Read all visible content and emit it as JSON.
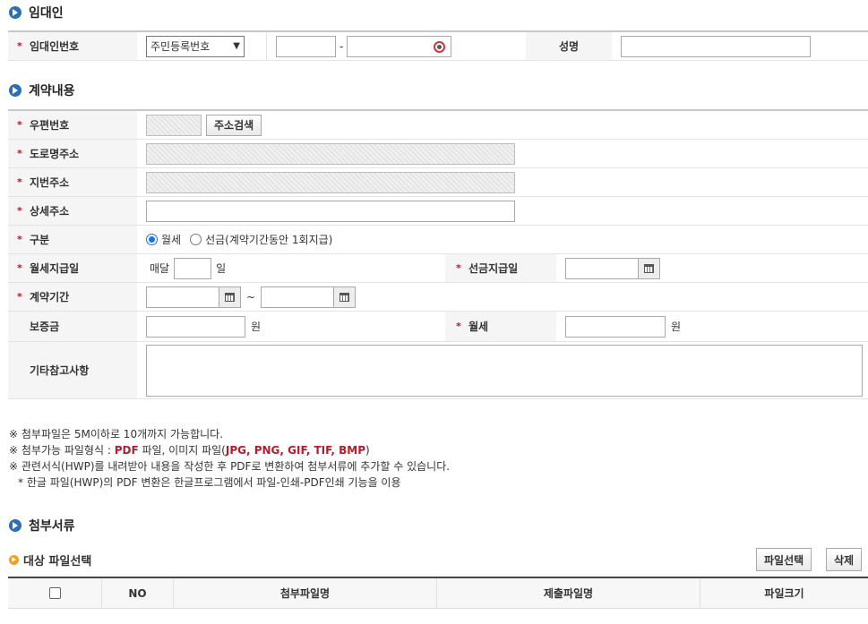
{
  "landlord": {
    "section_title": "임대인",
    "id_label": "임대인번호",
    "id_type_selected": "주민등록번호",
    "id_separator": "-",
    "name_label": "성명"
  },
  "contract": {
    "section_title": "계약내용",
    "postcode_label": "우편번호",
    "address_search_btn": "주소검색",
    "road_address_label": "도로명주소",
    "lot_address_label": "지번주소",
    "detail_address_label": "상세주소",
    "type_label": "구분",
    "type_options": [
      "월세",
      "선금(계약기간동안 1회지급)"
    ],
    "monthly_pay_day_label": "월세지급일",
    "monthly_prefix": "매달",
    "monthly_suffix": "일",
    "advance_pay_day_label": "선금지급일",
    "period_label": "계약기간",
    "period_sep": "~",
    "deposit_label": "보증금",
    "deposit_unit": "원",
    "rent_label": "월세",
    "rent_unit": "원",
    "etc_label": "기타참고사항"
  },
  "notes": {
    "line1": "※ 첨부파일은 5M이하로 10개까지 가능합니다.",
    "line2_prefix": "※ 첨부가능 파일형식 : ",
    "line2_pdf": "PDF",
    "line2_mid": " 파일, 이미지 파일(",
    "line2_imgs": "JPG, PNG, GIF, TIF, BMP",
    "line2_suffix": ")",
    "line3": "※ 관련서식(HWP)를 내려받아 내용을 작성한 후 PDF로 변환하여 첨부서류에 추가할 수 있습니다.",
    "line4": "* 한글 파일(HWP)의 PDF 변환은 한글프로그램에서 파일-인쇄-PDF인쇄 기능을 이용"
  },
  "attachments": {
    "section_title": "첨부서류",
    "sub_title": "대상 파일선택",
    "select_btn": "파일선택",
    "delete_btn": "삭제",
    "columns": [
      "NO",
      "첨부파일명",
      "제출파일명",
      "파일크기"
    ]
  },
  "required_mark": "*",
  "colors": {
    "required": "#c4161c",
    "accent": "#2a6fb8",
    "highlight": "#b11d2b"
  }
}
